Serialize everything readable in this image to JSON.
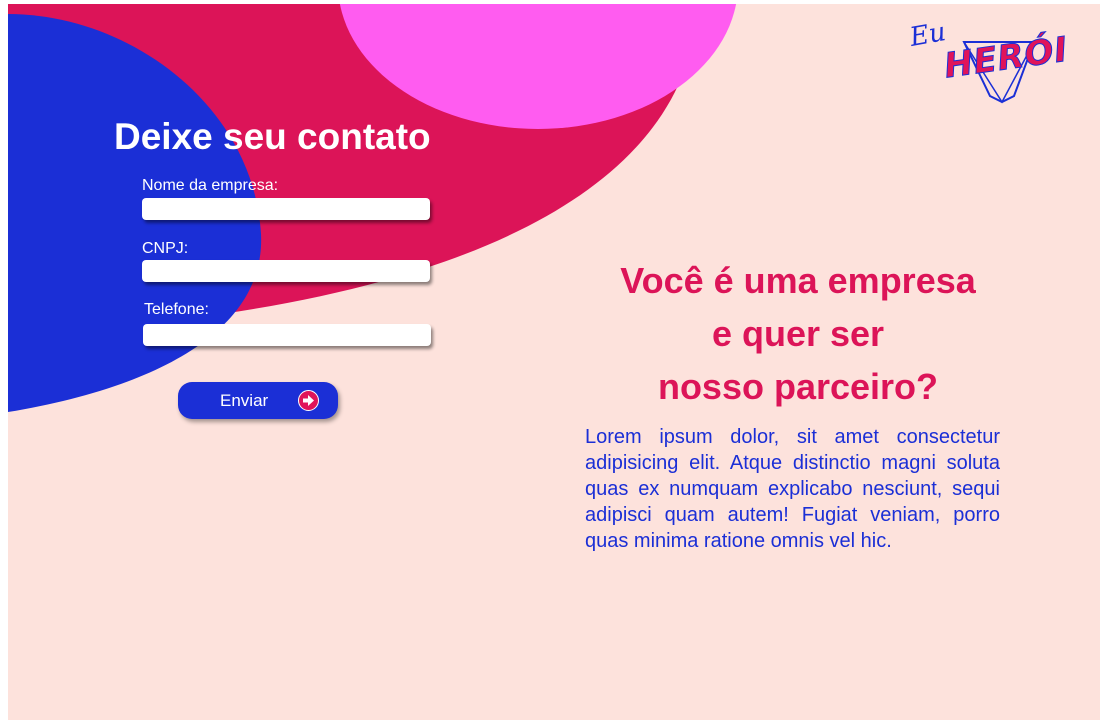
{
  "brand": {
    "logo_eu": "Eu",
    "logo_heroi": "HERÓI"
  },
  "form": {
    "title": "Deixe seu contato",
    "fields": [
      {
        "label": "Nome da empresa:",
        "value": "",
        "placeholder": ""
      },
      {
        "label": "CNPJ:",
        "value": "",
        "placeholder": ""
      },
      {
        "label": "Telefone:",
        "value": "",
        "placeholder": ""
      }
    ],
    "submit_label": "Enviar",
    "submit_icon": "arrow-right-circle-icon"
  },
  "promo": {
    "headline_lines": [
      "Você é uma empresa",
      "e quer ser",
      "nosso parceiro?"
    ],
    "body": "Lorem ipsum dolor, sit amet consectetur adipisicing elit. Atque distinctio magni soluta quas ex numquam explicabo nesciunt, sequi adipisci quam autem! Fugiat veniam, porro quas minima ratione omnis vel hic."
  },
  "colors": {
    "background": "#fde2dc",
    "blue": "#1b2fd6",
    "crimson": "#dc1458",
    "pink": "#ff5cf0",
    "white": "#ffffff"
  }
}
